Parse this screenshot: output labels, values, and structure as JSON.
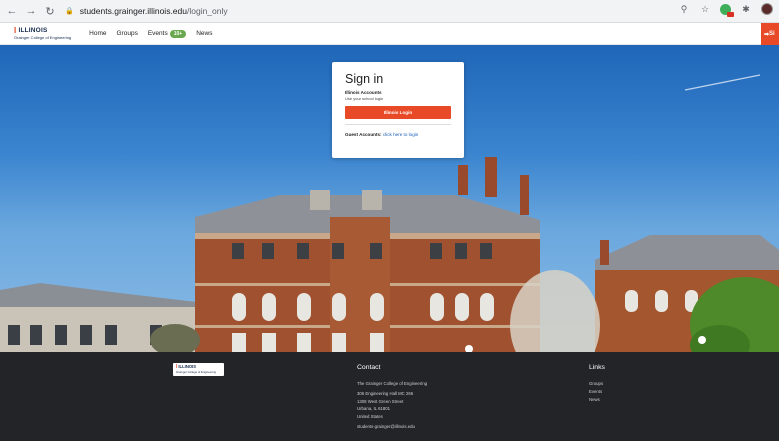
{
  "browser": {
    "url_host": "students.grainger.illinois.edu",
    "url_path": "/login_only"
  },
  "header": {
    "brand_name": "ILLINOIS",
    "brand_sub": "Grainger College of Engineering",
    "nav": [
      {
        "label": "Home"
      },
      {
        "label": "Groups"
      },
      {
        "label": "Events",
        "badge": "10+"
      },
      {
        "label": "News"
      }
    ],
    "signup_label": "Si"
  },
  "signin": {
    "title": "Sign in",
    "accounts_title": "Illinois Accounts",
    "accounts_hint": "Use your school login",
    "button_label": "Illinois Login",
    "guest_label": "Guest Accounts:",
    "guest_link": "click here to login"
  },
  "footer": {
    "logo_name": "ILLINOIS",
    "logo_sub": "Grainger College of Engineering",
    "contact": {
      "title": "Contact",
      "org": "The Grainger College of Engineering",
      "address1": "306 Engineering Hall MC 266",
      "address2": "1308 West Green Street",
      "address3": "Urbana, IL 61801",
      "address4": "United States",
      "email": "students-grainger@illinois.edu"
    },
    "links": {
      "title": "Links",
      "items": [
        "Groups",
        "Events",
        "News"
      ]
    }
  },
  "colors": {
    "accent": "#e84a27",
    "navy": "#13294b",
    "footer_bg": "#232428",
    "badge": "#6aa84f"
  }
}
